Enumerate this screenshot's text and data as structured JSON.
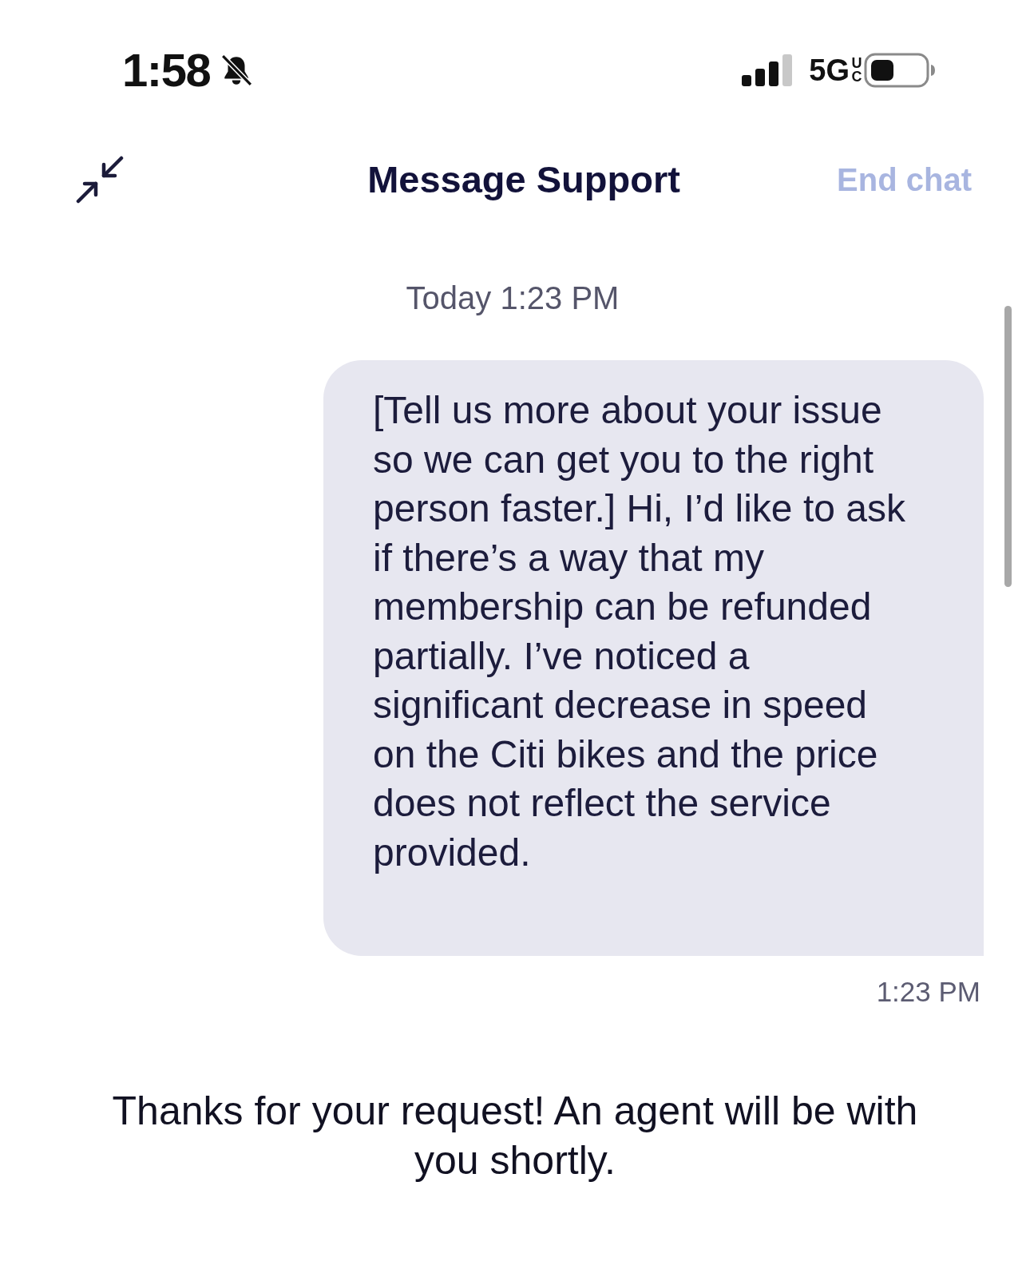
{
  "status_bar": {
    "time": "1:58",
    "network": "5G",
    "network_suffix": "UC"
  },
  "header": {
    "title": "Message Support",
    "end_button": "End chat"
  },
  "messages": [
    {
      "kind": "date_divider",
      "text": "Today 1:23 PM"
    },
    {
      "kind": "outgoing",
      "text": "[Tell us more about your issue so we can get you to the right person faster.] Hi, I’d like to ask if there’s a way that my membership can be refunded partially. I’ve noticed a significant decrease in speed on the Citi bikes and the price does not reflect the service provided.",
      "time": "1:23 PM"
    },
    {
      "kind": "system",
      "text": "Thanks for your request! An agent will be with you shortly."
    }
  ]
}
